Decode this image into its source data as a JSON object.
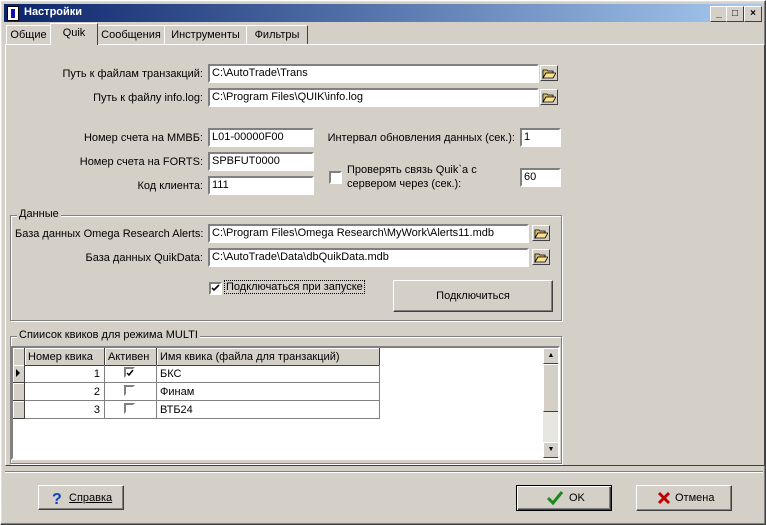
{
  "window": {
    "title": "Настройки"
  },
  "tabs": [
    {
      "label": "Общие"
    },
    {
      "label": "Quik"
    },
    {
      "label": "Сообщения"
    },
    {
      "label": "Инструменты"
    },
    {
      "label": "Фильтры"
    }
  ],
  "quik": {
    "trans_path_label": "Путь к файлам транзакций:",
    "trans_path_value": "C:\\AutoTrade\\Trans",
    "info_log_label": "Путь к файлу info.log:",
    "info_log_value": "C:\\Program Files\\QUIK\\info.log",
    "mmvb_label": "Номер счета на ММВБ:",
    "mmvb_value": "L01-00000F00",
    "forts_label": "Номер счета на FORTS:",
    "forts_value": "SPBFUT0000",
    "client_label": "Код клиента:",
    "client_value": "111",
    "interval_label": "Интервал обновления данных (сек.):",
    "interval_value": "1",
    "check_label_line1": "Проверять связь Quik`a с",
    "check_label_line2": "сервером через (сек.):",
    "check_checked": false,
    "check_value": "60"
  },
  "data_group": {
    "title": "Данные",
    "omega_label": "База данных Omega Research Alerts:",
    "omega_value": "C:\\Program Files\\Omega Research\\MyWork\\Alerts11.mdb",
    "quikdata_label": "База данных QuikData:",
    "quikdata_value": "C:\\AutoTrade\\Data\\dbQuikData.mdb",
    "autoconnect_label": "Подключаться при запуске",
    "autoconnect_checked": true,
    "connect_button": "Подключиться"
  },
  "multi_group": {
    "title": "Спиисок квиков для режима MULTI",
    "columns": [
      "Номер квика",
      "Активен",
      "Имя квика (файла для транзакций)"
    ],
    "rows": [
      {
        "number": "1",
        "active": true,
        "name": "БКС"
      },
      {
        "number": "2",
        "active": false,
        "name": "Финам"
      },
      {
        "number": "3",
        "active": false,
        "name": "ВТБ24"
      }
    ]
  },
  "footer": {
    "help_button": "Справка",
    "ok_button": "OK",
    "cancel_button": "Отмена"
  },
  "colors": {
    "face": "#d4d0c8",
    "title_start": "#0a246a",
    "title_end": "#a6caf0",
    "ok_check": "#1a8a1a",
    "cancel_x": "#c00000",
    "help_question": "#1040c0"
  },
  "icons": [
    "app-icon",
    "minimize-icon",
    "maximize-icon",
    "close-icon",
    "folder-open-icon",
    "row-pointer-icon",
    "question-icon",
    "check-icon",
    "cross-icon"
  ]
}
